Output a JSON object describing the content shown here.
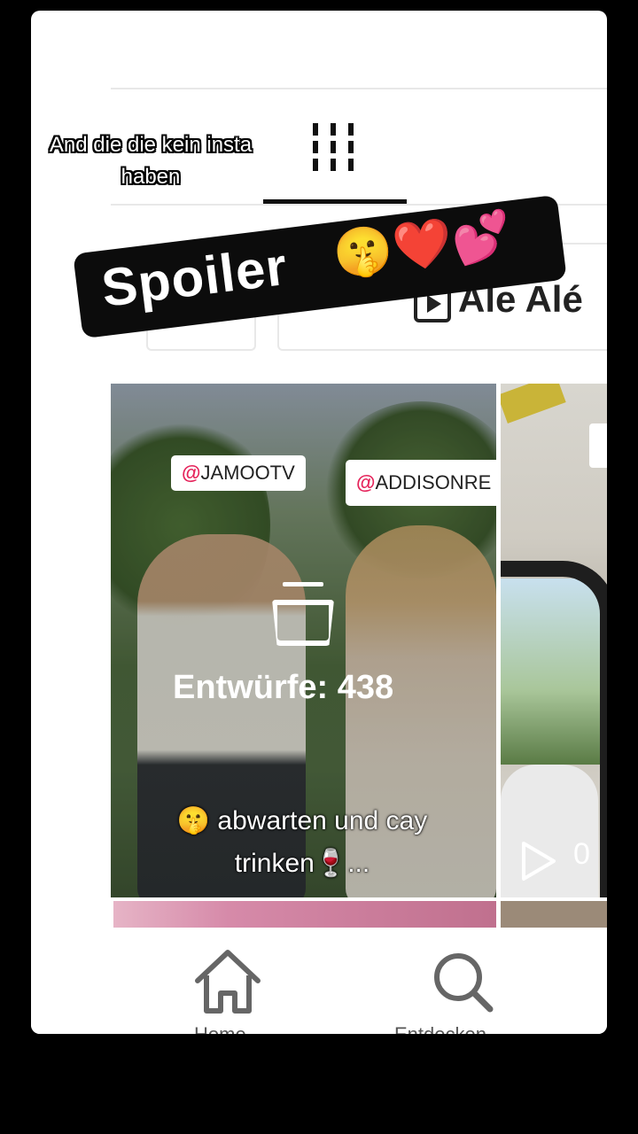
{
  "overlay": {
    "caption_small": "And die die kein insta haben",
    "spoiler_text": "Spoiler",
    "spoiler_emojis": "🤫❤️💕"
  },
  "tabs": {
    "grid_icon": "grid-icon"
  },
  "chips": {
    "right_label": "Ale Alé"
  },
  "tile": {
    "tags": {
      "left": "JAMOOTV",
      "right": "ADDISONRE",
      "at_symbol": "@"
    },
    "drafts_label": "Entwürfe: 438",
    "caption_line1": "🤫 abwarten und cay",
    "caption_line2": "trinken🍷..."
  },
  "tile2": {
    "play_count": "0"
  },
  "nav": {
    "home_label": "Home",
    "search_label": "Entdecken"
  },
  "colors": {
    "accent": "#e5245b",
    "background": "#000000",
    "panel": "#ffffff"
  }
}
